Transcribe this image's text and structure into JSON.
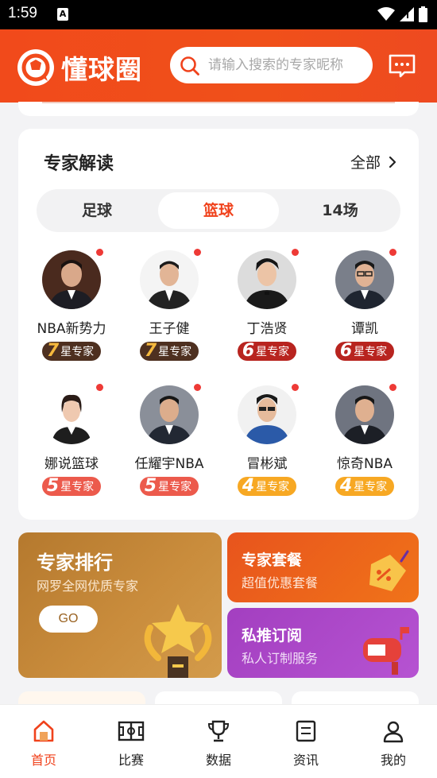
{
  "status_bar": {
    "time": "1:59",
    "note_icon": "A"
  },
  "header": {
    "app_name": "懂球圈",
    "search_placeholder": "请输入搜索的专家昵称"
  },
  "experts_section": {
    "title": "专家解读",
    "all_label": "全部",
    "tabs": [
      {
        "label": "足球",
        "active": false
      },
      {
        "label": "篮球",
        "active": true
      },
      {
        "label": "14场",
        "active": false
      }
    ],
    "experts": [
      {
        "name": "NBA新势力",
        "level": "7",
        "level_suffix": "星专家"
      },
      {
        "name": "王子健",
        "level": "7",
        "level_suffix": "星专家"
      },
      {
        "name": "丁浩贤",
        "level": "6",
        "level_suffix": "星专家"
      },
      {
        "name": "谭凯",
        "level": "6",
        "level_suffix": "星专家"
      },
      {
        "name": "娜说篮球",
        "level": "5",
        "level_suffix": "星专家"
      },
      {
        "name": "任耀宇NBA",
        "level": "5",
        "level_suffix": "星专家"
      },
      {
        "name": "冒彬斌",
        "level": "4",
        "level_suffix": "星专家"
      },
      {
        "name": "惊奇NBA",
        "level": "4",
        "level_suffix": "星专家"
      }
    ]
  },
  "promo": {
    "rank": {
      "title": "专家排行",
      "subtitle": "网罗全网优质专家",
      "button": "GO"
    },
    "package": {
      "title": "专家套餐",
      "subtitle": "超值优惠套餐"
    },
    "subscribe": {
      "title": "私推订阅",
      "subtitle": "私人订制服务"
    }
  },
  "tabbar": [
    {
      "label": "首页",
      "icon": "home-icon",
      "active": true
    },
    {
      "label": "比赛",
      "icon": "court-icon",
      "active": false
    },
    {
      "label": "数据",
      "icon": "trophy-icon",
      "active": false
    },
    {
      "label": "资讯",
      "icon": "news-icon",
      "active": false
    },
    {
      "label": "我的",
      "icon": "user-icon",
      "active": false
    }
  ],
  "colors": {
    "brand": "#f0421c",
    "header": "#f14a1b"
  }
}
